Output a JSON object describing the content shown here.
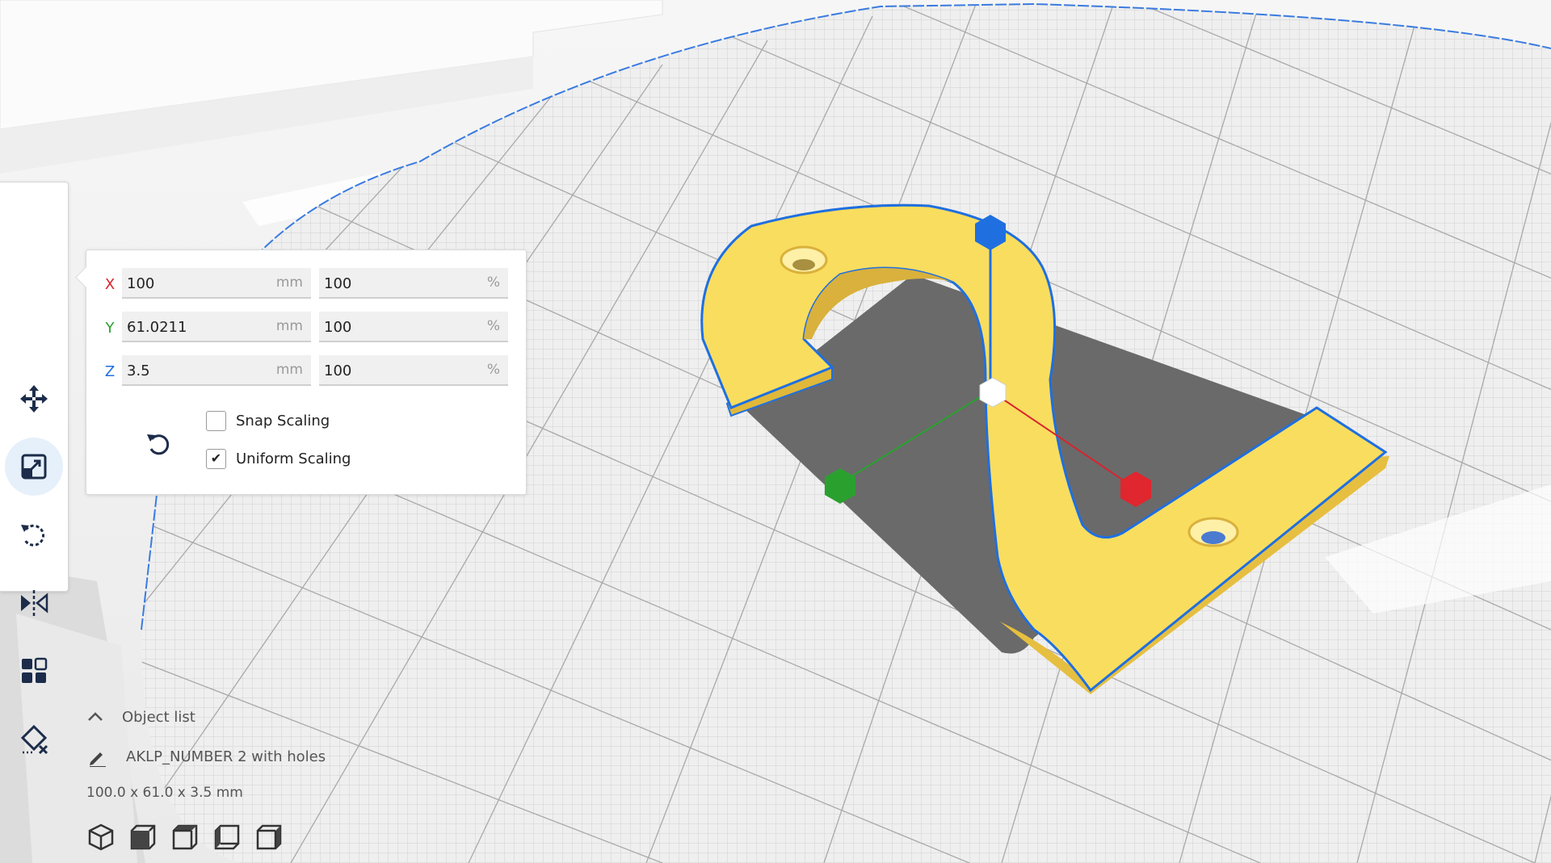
{
  "scale_panel": {
    "rows": [
      {
        "axis": "X",
        "axis_color": "#d9232e",
        "mm": "100",
        "pct": "100"
      },
      {
        "axis": "Y",
        "axis_color": "#2aa12e",
        "mm": "61.0211",
        "pct": "100"
      },
      {
        "axis": "Z",
        "axis_color": "#1f6fe0",
        "mm": "3.5",
        "pct": "100"
      }
    ],
    "unit_mm": "mm",
    "unit_pct": "%",
    "snap_scaling": {
      "label": "Snap Scaling",
      "checked": false
    },
    "uniform_scaling": {
      "label": "Uniform Scaling",
      "checked": true
    }
  },
  "toolbar": {
    "tools": [
      {
        "icon": "move-icon",
        "active": false
      },
      {
        "icon": "scale-icon",
        "active": true
      },
      {
        "icon": "rotate-icon",
        "active": false
      },
      {
        "icon": "mirror-icon",
        "active": false
      },
      {
        "icon": "per-model-settings-icon",
        "active": false
      },
      {
        "icon": "support-blocker-icon",
        "active": false
      }
    ]
  },
  "object_info": {
    "list_title": "Object list",
    "object_name": "AKLP_NUMBER 2 with holes",
    "dimensions": "100.0 x 61.0 x 3.5 mm"
  },
  "colors": {
    "accent": "#1f6fe0",
    "model": "#f8dc5e",
    "axis_x": "#d9232e",
    "axis_y": "#2aa12e",
    "axis_z": "#1f6fe0"
  }
}
